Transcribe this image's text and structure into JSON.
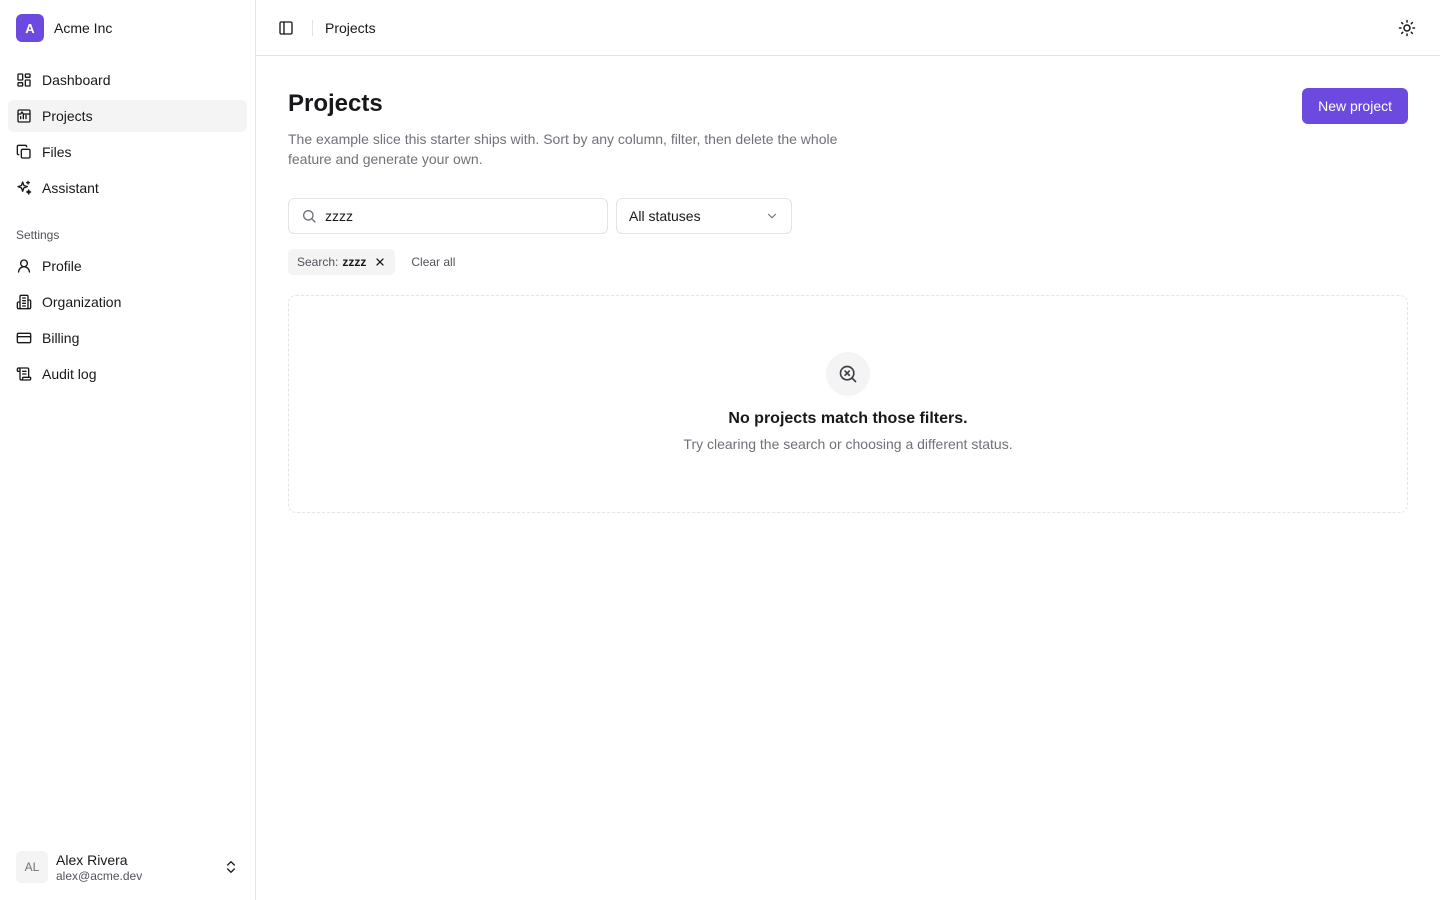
{
  "org": {
    "initial": "A",
    "name": "Acme Inc"
  },
  "nav": {
    "items": [
      {
        "label": "Dashboard",
        "icon": "dashboard-icon"
      },
      {
        "label": "Projects",
        "icon": "projects-icon",
        "active": true
      },
      {
        "label": "Files",
        "icon": "files-icon"
      },
      {
        "label": "Assistant",
        "icon": "sparkles-icon"
      }
    ],
    "settings_label": "Settings",
    "settings_items": [
      {
        "label": "Profile",
        "icon": "user-icon"
      },
      {
        "label": "Organization",
        "icon": "building-icon"
      },
      {
        "label": "Billing",
        "icon": "credit-card-icon"
      },
      {
        "label": "Audit log",
        "icon": "scroll-icon"
      }
    ]
  },
  "user": {
    "initials": "AL",
    "name": "Alex Rivera",
    "email": "alex@acme.dev"
  },
  "topbar": {
    "breadcrumb": "Projects"
  },
  "page": {
    "title": "Projects",
    "description": "The example slice this starter ships with. Sort by any column, filter, then delete the whole feature and generate your own.",
    "new_button": "New project"
  },
  "filters": {
    "search_value": "zzzz",
    "status_selected": "All statuses",
    "chip_label": "Search:",
    "chip_value": "zzzz",
    "clear_all": "Clear all"
  },
  "empty_state": {
    "title": "No projects match those filters.",
    "description": "Try clearing the search or choosing a different status."
  },
  "colors": {
    "accent": "#6d4adf",
    "border": "#e4e4e7",
    "muted_text": "#71717a",
    "active_bg": "#f4f4f5"
  }
}
